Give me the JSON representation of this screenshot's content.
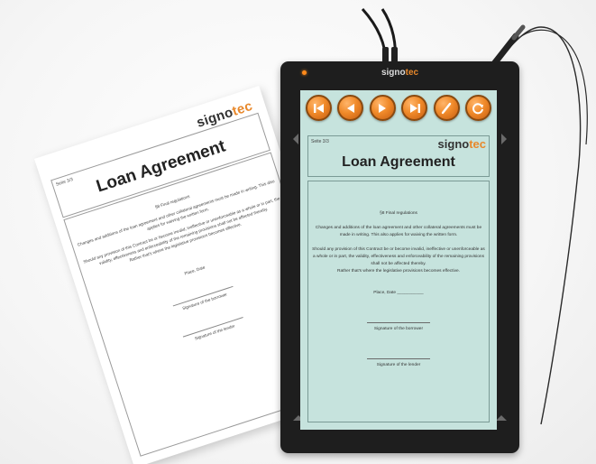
{
  "paper": {
    "brand_a": "signo",
    "brand_b": "tec",
    "page": "Seite 3/3",
    "title": "Loan Agreement",
    "section": "§8 Final regulations",
    "para1": "Changes and additions of the loan agreement and other collateral agreements must be made in writing. This also applies for waiving the written form.",
    "para2": "Should any provision of this Contract be or become invalid, ineffective or unenforceable as a whole or in part, the validity, effectiveness and enforceability of the remaining provisions shall not be affected thereby.",
    "para3": "Rather that's where the legislative provisions becomes effective.",
    "place_date": "Place, Date",
    "sig_borrower": "Signature of the borrower",
    "sig_lender": "Signature of the lender"
  },
  "tablet": {
    "brand_a": "signo",
    "brand_b": "tec",
    "led_color": "#ff8a1a",
    "buttons": [
      {
        "name": "first-page-icon"
      },
      {
        "name": "previous-page-icon"
      },
      {
        "name": "next-page-icon"
      },
      {
        "name": "last-page-icon"
      },
      {
        "name": "pen-icon"
      },
      {
        "name": "refresh-icon"
      }
    ]
  },
  "screen": {
    "page": "Seite 3/3",
    "brand_a": "signo",
    "brand_b": "tec",
    "title": "Loan Agreement",
    "section": "§8 Final regulations",
    "para1": "Changes and additions of the loan agreement and other collateral agreements must be made in writing. This also applies for waiving the written form.",
    "para2": "Should any provision of this Contract be or become invalid, ineffective or unenforceable as a whole or in part, the validity, effectiveness and enforceability of the remaining provisions shall not be affected thereby.",
    "para3": "Rather that's where the legislative provisions becomes effective.",
    "place_date": "Place, Date ___________",
    "sig_borrower": "Signature of the borrower",
    "sig_lender": "Signature of the lender",
    "screen_color": "#c6e3dd",
    "button_color": "#f08a2a"
  }
}
